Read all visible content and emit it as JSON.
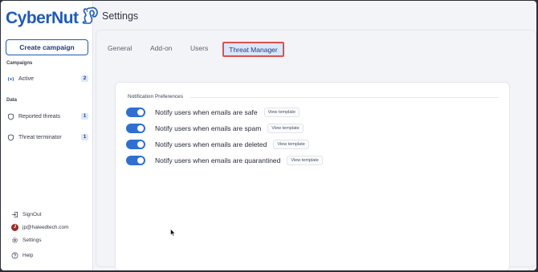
{
  "app": {
    "brand": "CyberNut",
    "page_title": "Settings"
  },
  "sidebar": {
    "create_button": "Create campaign",
    "campaigns_label": "Campaigns",
    "campaigns": [
      {
        "label": "Active",
        "count": "2",
        "icon": "broadcast-icon"
      }
    ],
    "data_label": "Data",
    "data_items": [
      {
        "label": "Reported threats",
        "count": "1",
        "icon": "shield-icon"
      },
      {
        "label": "Threat terminator",
        "count": "1",
        "icon": "shield-icon"
      }
    ],
    "bottom": {
      "signout": "SignOut",
      "user_initial": "J",
      "user_email": "jp@haleedtech.com",
      "settings": "Settings",
      "help": "Help"
    }
  },
  "tabs": [
    {
      "label": "General"
    },
    {
      "label": "Add-on"
    },
    {
      "label": "Users"
    },
    {
      "label": "Threat Manager",
      "active": true
    }
  ],
  "card": {
    "title": "Notification Preferences",
    "preferences": [
      {
        "label": "Notify users when emails are safe",
        "enabled": true,
        "action": "View template"
      },
      {
        "label": "Notify users when emails are spam",
        "enabled": true,
        "action": "View template"
      },
      {
        "label": "Notify users when emails are deleted",
        "enabled": true,
        "action": "View template"
      },
      {
        "label": "Notify users when emails are quarantined",
        "enabled": true,
        "action": "View template"
      }
    ]
  },
  "colors": {
    "brand": "#1e5bb8",
    "toggle_on": "#2f6fd1",
    "highlight_border": "#e0524b",
    "active_tab_bg": "#dbe6fb"
  }
}
